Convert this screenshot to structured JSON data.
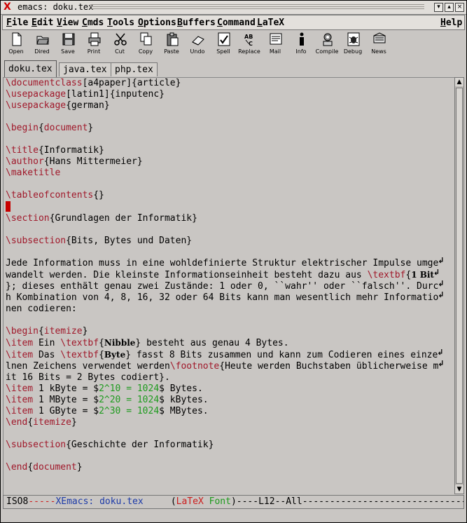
{
  "window": {
    "title": "emacs: doku.tex",
    "accent_red": "#d00000"
  },
  "menu": [
    "File",
    "Edit",
    "View",
    "Cmds",
    "Tools",
    "Options",
    "Buffers",
    "Command",
    "LaTeX"
  ],
  "help": "Help",
  "toolbar": [
    {
      "label": "Open",
      "icon": "open-file-icon"
    },
    {
      "label": "Dired",
      "icon": "dired-folder-icon"
    },
    {
      "label": "Save",
      "icon": "save-disk-icon"
    },
    {
      "label": "Print",
      "icon": "printer-icon"
    },
    {
      "label": "Cut",
      "icon": "scissors-icon"
    },
    {
      "label": "Copy",
      "icon": "copy-icon"
    },
    {
      "label": "Paste",
      "icon": "clipboard-icon"
    },
    {
      "label": "Undo",
      "icon": "eraser-icon"
    },
    {
      "label": "Spell",
      "icon": "spell-check-icon"
    },
    {
      "label": "Replace",
      "icon": "replace-icon"
    },
    {
      "label": "Mail",
      "icon": "mail-icon"
    },
    {
      "label": "Info",
      "icon": "info-icon"
    },
    {
      "label": "Compile",
      "icon": "compile-icon"
    },
    {
      "label": "Debug",
      "icon": "debug-icon"
    },
    {
      "label": "News",
      "icon": "news-icon"
    }
  ],
  "tabs": [
    "doku.tex",
    "java.tex",
    "php.tex"
  ],
  "active_tab": 0,
  "code": [
    [
      [
        "k",
        "\\documentclass"
      ],
      [
        "t",
        "[a4paper]{article}"
      ]
    ],
    [
      [
        "k",
        "\\usepackage"
      ],
      [
        "t",
        "[latin1]{inputenc}"
      ]
    ],
    [
      [
        "k",
        "\\usepackage"
      ],
      [
        "t",
        "{german}"
      ]
    ],
    [],
    [
      [
        "k",
        "\\begin"
      ],
      [
        "t",
        "{"
      ],
      [
        "k",
        "document"
      ],
      [
        "t",
        "}"
      ]
    ],
    [],
    [
      [
        "k",
        "\\title"
      ],
      [
        "t",
        "{Informatik}"
      ]
    ],
    [
      [
        "k",
        "\\author"
      ],
      [
        "t",
        "{Hans Mittermeier}"
      ]
    ],
    [
      [
        "k",
        "\\maketitle"
      ]
    ],
    [],
    [
      [
        "k",
        "\\tableofcontents"
      ],
      [
        "t",
        "{}"
      ]
    ],
    [
      [
        "c",
        ""
      ]
    ],
    [
      [
        "k",
        "\\section"
      ],
      [
        "t",
        "{Grundlagen der Informatik}"
      ]
    ],
    [],
    [
      [
        "k",
        "\\subsection"
      ],
      [
        "t",
        "{Bits, Bytes und Daten}"
      ]
    ],
    [],
    [
      [
        "t",
        "Jede Information muss in eine wohldefinierte Struktur elektrischer Impulse umge"
      ],
      [
        "w",
        ""
      ]
    ],
    [
      [
        "t",
        "wandelt werden. Die kleinste Informationseinheit besteht dazu aus "
      ],
      [
        "k",
        "\\textbf"
      ],
      [
        "t",
        "{"
      ],
      [
        "b",
        "1 Bit"
      ],
      [
        "w",
        ""
      ]
    ],
    [
      [
        "t",
        "}; dieses enthält genau zwei Zustände: 1 oder 0, ``wahr'' oder ``falsch''. Durc"
      ],
      [
        "w",
        ""
      ]
    ],
    [
      [
        "t",
        "h Kombination von 4, 8, 16, 32 oder 64 Bits kann man wesentlich mehr Informatio"
      ],
      [
        "w",
        ""
      ]
    ],
    [
      [
        "t",
        "nen codieren:"
      ]
    ],
    [],
    [
      [
        "k",
        "\\begin"
      ],
      [
        "t",
        "{"
      ],
      [
        "k",
        "itemize"
      ],
      [
        "t",
        "}"
      ]
    ],
    [
      [
        "k",
        "\\item"
      ],
      [
        "t",
        " Ein "
      ],
      [
        "k",
        "\\textbf"
      ],
      [
        "t",
        "{"
      ],
      [
        "b",
        "Nibble"
      ],
      [
        "t",
        "} besteht aus genau 4 Bytes."
      ]
    ],
    [
      [
        "k",
        "\\item"
      ],
      [
        "t",
        " Das "
      ],
      [
        "k",
        "\\textbf"
      ],
      [
        "t",
        "{"
      ],
      [
        "b",
        "Byte"
      ],
      [
        "t",
        "} fasst 8 Bits zusammen und kann zum Codieren eines einze"
      ],
      [
        "w",
        ""
      ]
    ],
    [
      [
        "t",
        "lnen Zeichens verwendet werden"
      ],
      [
        "k",
        "\\footnote"
      ],
      [
        "t",
        "{Heute werden Buchstaben üblicherweise m"
      ],
      [
        "w",
        ""
      ]
    ],
    [
      [
        "t",
        "it 16 Bits = 2 Bytes codiert}."
      ]
    ],
    [
      [
        "k",
        "\\item"
      ],
      [
        "t",
        " 1 kByte = $"
      ],
      [
        "m",
        "2^10 = 1024"
      ],
      [
        "t",
        "$ Bytes."
      ]
    ],
    [
      [
        "k",
        "\\item"
      ],
      [
        "t",
        " 1 MByte = $"
      ],
      [
        "m",
        "2^20 = 1024"
      ],
      [
        "t",
        "$ kBytes."
      ]
    ],
    [
      [
        "k",
        "\\item"
      ],
      [
        "t",
        " 1 GByte = $"
      ],
      [
        "m",
        "2^30 = 1024"
      ],
      [
        "t",
        "$ MBytes."
      ]
    ],
    [
      [
        "k",
        "\\end"
      ],
      [
        "t",
        "{"
      ],
      [
        "k",
        "itemize"
      ],
      [
        "t",
        "}"
      ]
    ],
    [],
    [
      [
        "k",
        "\\subsection"
      ],
      [
        "t",
        "{Geschichte der Informatik}"
      ]
    ],
    [],
    [
      [
        "k",
        "\\end"
      ],
      [
        "t",
        "{"
      ],
      [
        "k",
        "document"
      ],
      [
        "t",
        "}"
      ]
    ]
  ],
  "modeline": {
    "encoding": "ISO8",
    "dashes1": "-----",
    "app": "XEmacs:",
    "buffer": "doku.tex",
    "mode_open": "(",
    "mode": "LaTeX",
    "minor": "Font",
    "mode_close": ")",
    "position": "----L12--All",
    "fill": "-------------------------------"
  }
}
